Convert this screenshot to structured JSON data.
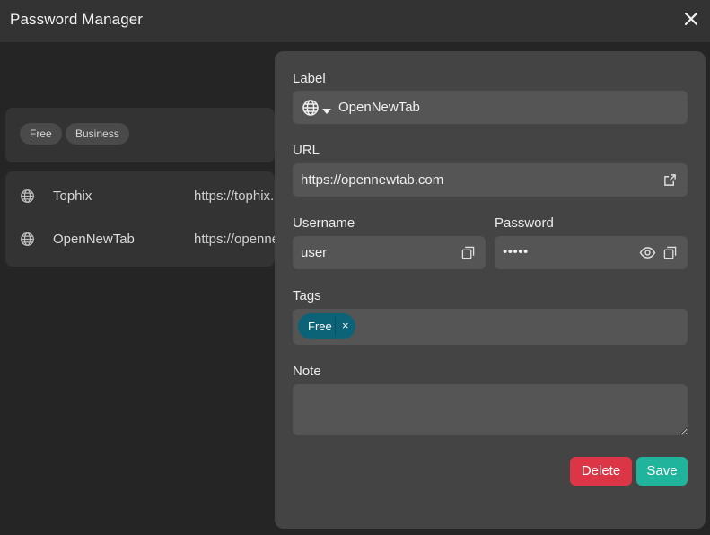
{
  "header": {
    "title": "Password Manager"
  },
  "filter_tags": [
    "Free",
    "Business"
  ],
  "entries": [
    {
      "name": "Tophix",
      "url": "https://tophix.com"
    },
    {
      "name": "OpenNewTab",
      "url": "https://opennewtab.com"
    }
  ],
  "editor": {
    "label": {
      "label": "Label",
      "value": "OpenNewTab"
    },
    "url": {
      "label": "URL",
      "value": "https://opennewtab.com"
    },
    "username": {
      "label": "Username",
      "value": "user"
    },
    "password": {
      "label": "Password",
      "masked": "•••••"
    },
    "tags": {
      "label": "Tags",
      "items": [
        "Free"
      ],
      "remove_glyph": "×"
    },
    "note": {
      "label": "Note",
      "value": ""
    },
    "delete_label": "Delete",
    "save_label": "Save"
  },
  "colors": {
    "delete": "#dc3545",
    "save": "#20b49c",
    "tag_chip": "#0c6276"
  },
  "icons": [
    "close-icon",
    "globe-icon",
    "chevron-down-icon",
    "external-link-icon",
    "copy-icon",
    "eye-icon"
  ]
}
